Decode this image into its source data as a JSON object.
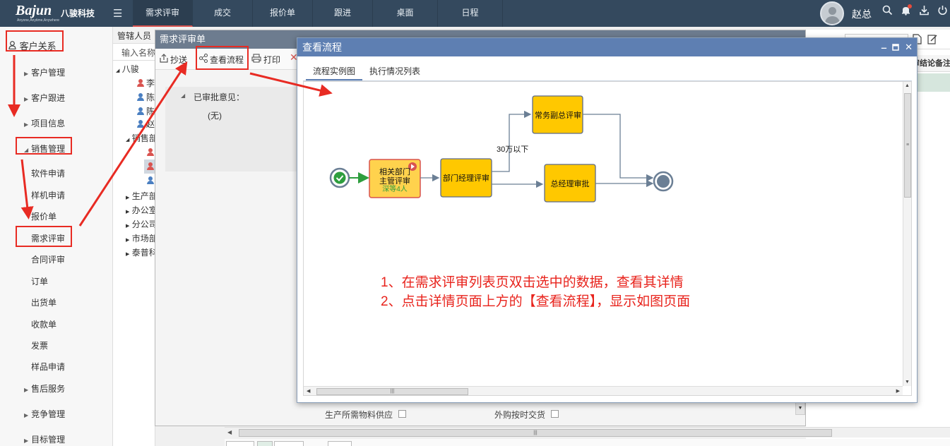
{
  "app": {
    "logo_text": "Bajun",
    "logo_cn": "八骏科技",
    "logo_slogan": "Anyone,Anytime,Anywhere",
    "user_name": "赵总"
  },
  "topnav": [
    {
      "label": "需求评审",
      "active": true
    },
    {
      "label": "成交"
    },
    {
      "label": "报价单"
    },
    {
      "label": "跟进"
    },
    {
      "label": "桌面"
    },
    {
      "label": "日程"
    }
  ],
  "sidebar": {
    "root": "客户关系",
    "items": [
      {
        "label": "客户管理",
        "type": "group"
      },
      {
        "label": "客户跟进",
        "type": "group"
      },
      {
        "label": "项目信息",
        "type": "group"
      },
      {
        "label": "销售管理",
        "type": "group-open"
      },
      {
        "label": "软件申请"
      },
      {
        "label": "样机申请"
      },
      {
        "label": "报价单"
      },
      {
        "label": "需求评审",
        "highlight": true
      },
      {
        "label": "合同评审"
      },
      {
        "label": "订单"
      },
      {
        "label": "出货单"
      },
      {
        "label": "收款单"
      },
      {
        "label": "发票"
      },
      {
        "label": "样品申请"
      },
      {
        "label": "售后服务",
        "type": "group"
      },
      {
        "label": "竞争管理",
        "type": "group"
      },
      {
        "label": "目标管理",
        "type": "group"
      }
    ]
  },
  "middle": {
    "header": "管辖人员",
    "filter_placeholder": "输入名称",
    "tree": [
      {
        "label": "八骏",
        "level": 0,
        "toggle": "▲"
      },
      {
        "label": "李",
        "level": 1,
        "person": "red"
      },
      {
        "label": "陈",
        "level": 1,
        "person": "blue"
      },
      {
        "label": "陈",
        "level": 1,
        "person": "blue"
      },
      {
        "label": "赵",
        "level": 1,
        "person": "blue"
      },
      {
        "label": "销售部",
        "level": 1,
        "toggle": "▲"
      },
      {
        "label": "",
        "level": 2,
        "person": "red"
      },
      {
        "label": "",
        "level": 2,
        "person": "red"
      },
      {
        "label": "",
        "level": 2,
        "person": "blue"
      },
      {
        "label": "生产部",
        "level": 1,
        "toggle": "▶"
      },
      {
        "label": "办公室",
        "level": 1,
        "toggle": "▶"
      },
      {
        "label": "分公司",
        "level": 1,
        "toggle": "▶"
      },
      {
        "label": "市场部",
        "level": 1,
        "toggle": "▶"
      },
      {
        "label": "泰普科",
        "level": 1,
        "toggle": "▶"
      }
    ]
  },
  "inner_window": {
    "title": "需求评审单",
    "toolbar": {
      "cc_label": "抄送",
      "view_flow_label": "查看流程",
      "print_label": "打印"
    },
    "approval_label": "已审批意见：",
    "approval_value": "(无)",
    "field_a": "生产所需物料供应",
    "field_b": "外购按时交货"
  },
  "right_panel": {
    "column_header": "审结论备注"
  },
  "dialog": {
    "title": "查看流程",
    "tabs": [
      "流程实例图",
      "执行情况列表"
    ],
    "active_tab": 0,
    "nodes": {
      "n1_line1": "相关部门",
      "n1_line2": "主管评审",
      "n1_waiting": "深等4人",
      "n2": "部门经理评审",
      "n3": "常务副总评审",
      "n4": "总经理审批"
    },
    "condition_label": "30万以下",
    "notes": [
      "1、在需求评审列表页双击选中的数据，查看其详情",
      "2、点击详情页面上方的【查看流程】，显示如图页面"
    ]
  },
  "colors": {
    "topbar": "#34495e",
    "dialog_title": "#5e7fb2",
    "node_fill": "#ffc800",
    "node_active_fill": "#ffd24d",
    "annotation_red": "#e82b23",
    "start_green": "#2e9e3e",
    "edge": "#6b7f95"
  }
}
